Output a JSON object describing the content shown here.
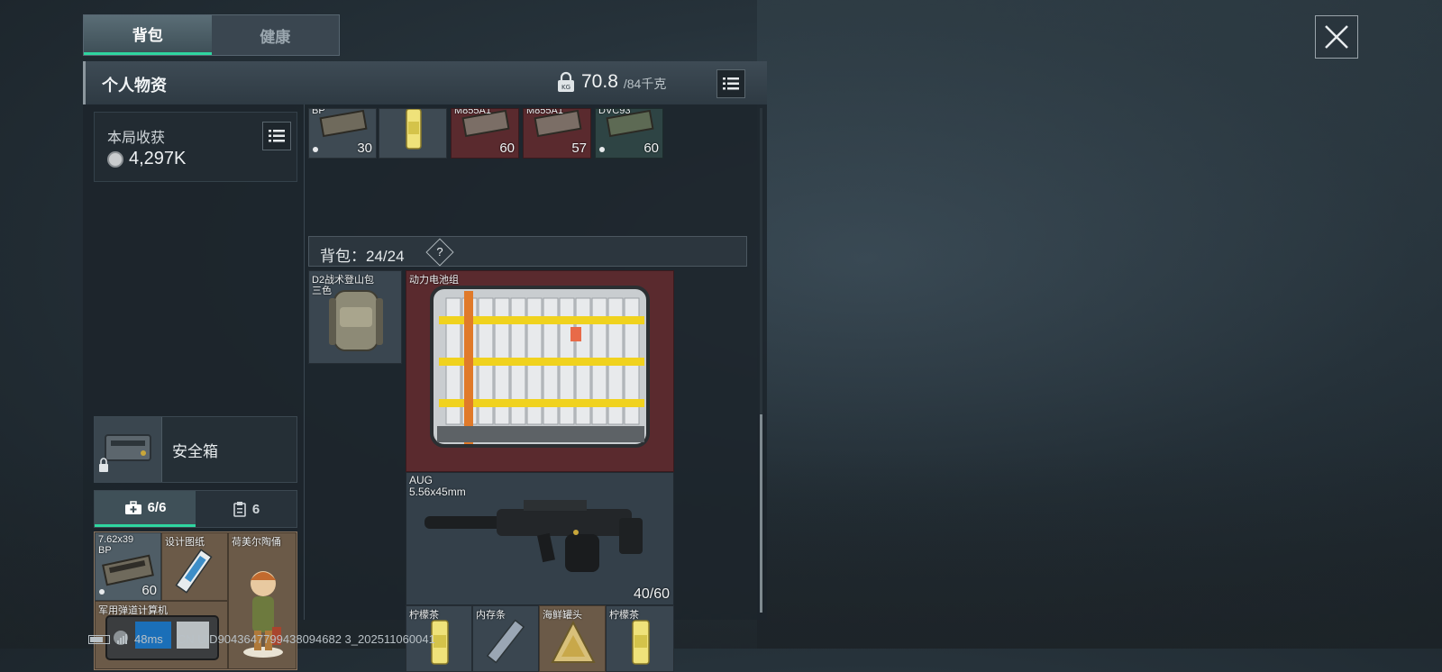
{
  "tabs": [
    {
      "label": "背包",
      "active": true
    },
    {
      "label": "健康",
      "active": false
    }
  ],
  "panel": {
    "title": "个人物资",
    "weight_current": "70.8",
    "weight_max": "/84千克",
    "weight_icon": "kg-lock-icon"
  },
  "haul": {
    "label": "本局收获",
    "value": "4,297K"
  },
  "safebox": {
    "label": "安全箱"
  },
  "sub_tabs": [
    {
      "label": "6/6",
      "icon": "medkit-icon"
    },
    {
      "label": "6",
      "icon": "clipboard-icon"
    }
  ],
  "pouch_items": [
    {
      "name": "7.62x39",
      "name2": "BP",
      "count": "60"
    },
    {
      "name": "设计图纸",
      "count": ""
    },
    {
      "name": "荷美尔陶俑",
      "count": ""
    },
    {
      "name": "军用弹道计算机",
      "count": ""
    }
  ],
  "top_row": [
    {
      "name": "BP",
      "count": "30"
    },
    {
      "name": "",
      "count": ""
    },
    {
      "name": "M855A1",
      "count": "60"
    },
    {
      "name": "M855A1",
      "count": "57"
    },
    {
      "name": "DVC93",
      "count": "60"
    }
  ],
  "bag": {
    "label": "背包：24/24",
    "help": "?"
  },
  "backpack": {
    "name": "D2战术登山包",
    "name2": "三色"
  },
  "battery_pack": {
    "name": "动力电池组"
  },
  "weapon": {
    "name": "AUG",
    "caliber": "5.56x45mm",
    "ammo": "40/60"
  },
  "bottom_row": [
    {
      "name": "柠檬茶"
    },
    {
      "name": "内存条"
    },
    {
      "name": "海鲜罐头"
    },
    {
      "name": "柠檬茶"
    }
  ],
  "status": {
    "ping": "48ms",
    "uid": "CN UID9043647799438094682 3_202511060041"
  },
  "colors": {
    "accent": "#2fd6a0",
    "rare_red": "#5a2a2e",
    "pouch_bg": "#6b5a48"
  }
}
